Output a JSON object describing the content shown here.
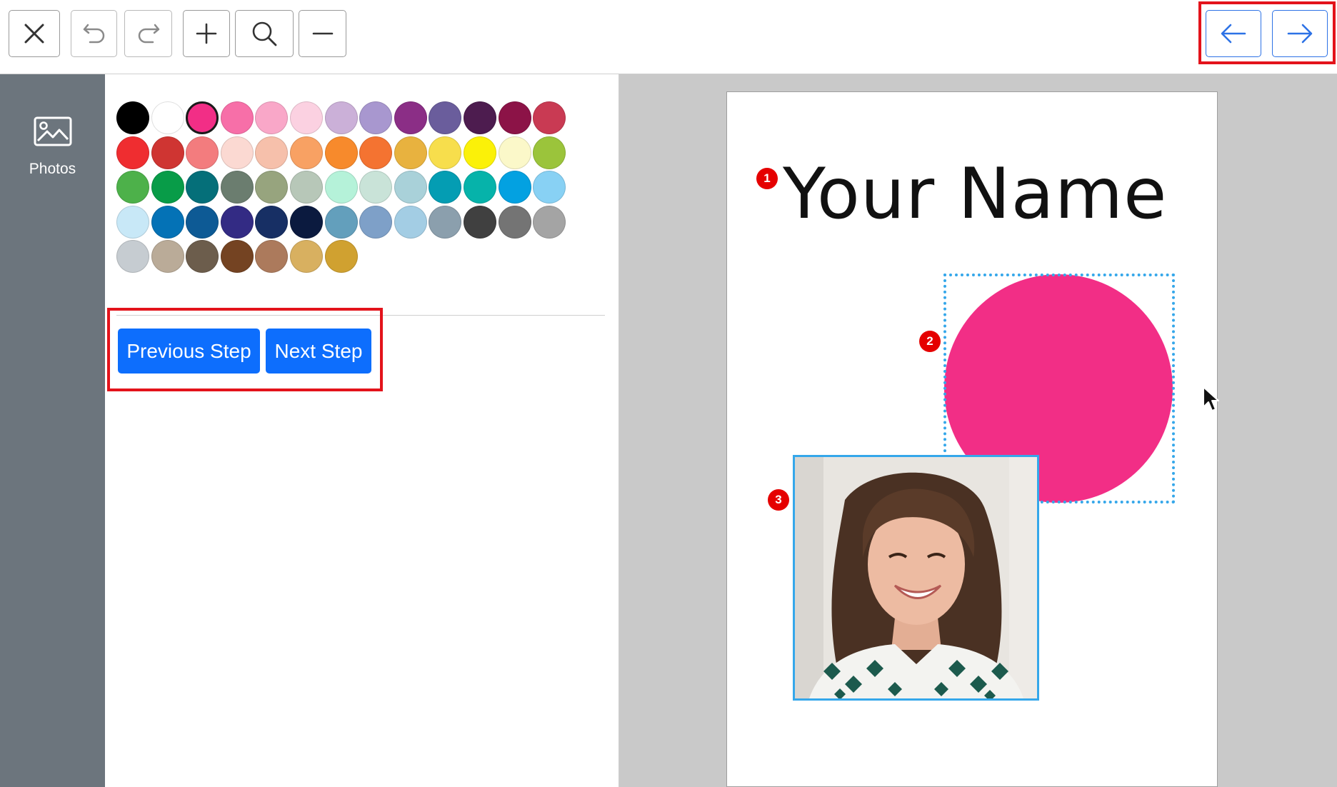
{
  "toolbar": {
    "buttons": [
      {
        "name": "close-icon",
        "label": "Close"
      },
      {
        "name": "undo-icon",
        "label": "Undo"
      },
      {
        "name": "redo-icon",
        "label": "Redo"
      },
      {
        "name": "plus-icon",
        "label": "Add"
      },
      {
        "name": "search-icon",
        "label": "Zoom"
      },
      {
        "name": "minus-icon",
        "label": "Remove"
      }
    ],
    "nav": {
      "back_icon": "arrow-left-icon",
      "forward_icon": "arrow-right-icon"
    }
  },
  "sidebar": {
    "items": [
      {
        "label": "Photos",
        "icon": "image-icon"
      }
    ]
  },
  "color_panel": {
    "selected_color": "#f22e86",
    "colors": [
      [
        "#000000",
        "#ffffff",
        "#f22e86",
        "#f76fa8",
        "#f9a7c8",
        "#fbd1e1",
        "#cbb0d8",
        "#a897cf",
        "#8b2e86",
        "#6a5d9c",
        "#4d1c4f",
        "#8c1347",
        "#c93a53"
      ],
      [
        "#ef2d30",
        "#cf3532",
        "#f37c7e",
        "#fbd9d2",
        "#f6c0ab",
        "#f8a163",
        "#f78a2c",
        "#f47331",
        "#e8b23f",
        "#f7de4c",
        "#fbf108",
        "#fbf8c9",
        "#9bc43b"
      ],
      [
        "#4db14a",
        "#089c48",
        "#056f79",
        "#6b7d6f",
        "#97a47e",
        "#b7c7b8",
        "#b5f2d9",
        "#c9e3d8",
        "#a9d1d9",
        "#049db3",
        "#06b3aa",
        "#03a1e1",
        "#88d1f4"
      ],
      [
        "#c8e8f7",
        "#0472b6",
        "#0d5a95",
        "#332b84",
        "#172f64",
        "#0b1a3f",
        "#639fbc",
        "#7ea0c8",
        "#a3cde4",
        "#8b9fad",
        "#404040",
        "#747474",
        "#a4a4a4"
      ],
      [
        "#c6ccd1",
        "#baab98",
        "#6c5d4c",
        "#744322",
        "#ac7a5c",
        "#d8b060",
        "#d0a130"
      ]
    ],
    "previous_label": "Previous Step",
    "next_label": "Next Step"
  },
  "canvas": {
    "title_text": "Your Name",
    "markers": [
      "1",
      "2",
      "3"
    ],
    "shape_color": "#f22e86",
    "selection_color": "#35a7ea"
  }
}
